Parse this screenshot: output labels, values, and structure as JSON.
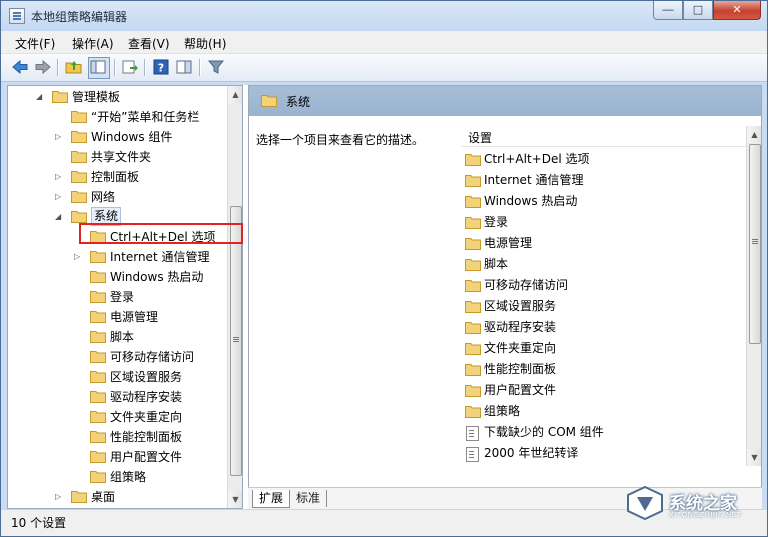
{
  "window": {
    "title": "本地组策略编辑器",
    "caption_minimize": "▭",
    "caption_maximize": "▢",
    "caption_close": "✕"
  },
  "menubar": {
    "items": [
      "文件(F)",
      "操作(A)",
      "查看(V)",
      "帮助(H)"
    ]
  },
  "toolbar": {
    "icons": [
      "back-icon",
      "forward-icon",
      "up-folder-icon",
      "show-hide-tree-icon",
      "export-list-icon",
      "help-icon",
      "properties-pane-icon",
      "filter-icon"
    ]
  },
  "tree": {
    "items": [
      {
        "label": "管理模板",
        "expander": "◢",
        "expanded": true
      },
      {
        "label": "“开始”菜单和任务栏",
        "expander": ""
      },
      {
        "label": "Windows 组件",
        "expander": "▷"
      },
      {
        "label": "共享文件夹",
        "expander": ""
      },
      {
        "label": "控制面板",
        "expander": "▷"
      },
      {
        "label": "网络",
        "expander": "▷"
      },
      {
        "label": "系统",
        "expander": "◢",
        "expanded": true,
        "selected": true
      },
      {
        "label": "Ctrl+Alt+Del 选项",
        "expander": "",
        "highlighted": true
      },
      {
        "label": "Internet 通信管理",
        "expander": "▷"
      },
      {
        "label": "Windows 热启动",
        "expander": ""
      },
      {
        "label": "登录",
        "expander": ""
      },
      {
        "label": "电源管理",
        "expander": ""
      },
      {
        "label": "脚本",
        "expander": ""
      },
      {
        "label": "可移动存储访问",
        "expander": ""
      },
      {
        "label": "区域设置服务",
        "expander": ""
      },
      {
        "label": "驱动程序安装",
        "expander": ""
      },
      {
        "label": "文件夹重定向",
        "expander": ""
      },
      {
        "label": "性能控制面板",
        "expander": ""
      },
      {
        "label": "用户配置文件",
        "expander": ""
      },
      {
        "label": "组策略",
        "expander": ""
      },
      {
        "label": "桌面",
        "expander": "▷"
      }
    ]
  },
  "right_pane": {
    "header_title": "系统",
    "description": "选择一个项目来查看它的描述。",
    "column_header": "设置",
    "items": [
      {
        "label": "Ctrl+Alt+Del 选项",
        "type": "folder"
      },
      {
        "label": "Internet 通信管理",
        "type": "folder"
      },
      {
        "label": "Windows 热启动",
        "type": "folder"
      },
      {
        "label": "登录",
        "type": "folder"
      },
      {
        "label": "电源管理",
        "type": "folder"
      },
      {
        "label": "脚本",
        "type": "folder"
      },
      {
        "label": "可移动存储访问",
        "type": "folder"
      },
      {
        "label": "区域设置服务",
        "type": "folder"
      },
      {
        "label": "驱动程序安装",
        "type": "folder"
      },
      {
        "label": "文件夹重定向",
        "type": "folder"
      },
      {
        "label": "性能控制面板",
        "type": "folder"
      },
      {
        "label": "用户配置文件",
        "type": "folder"
      },
      {
        "label": "组策略",
        "type": "folder"
      },
      {
        "label": "下载缺少的 COM 组件",
        "type": "policy"
      },
      {
        "label": "2000 年世纪转译",
        "type": "policy"
      }
    ]
  },
  "tabs": [
    {
      "label": "扩展",
      "active": true
    },
    {
      "label": "标准",
      "active": false
    }
  ],
  "status": {
    "text": "10 个设置"
  },
  "watermark": {
    "text": "系统之家",
    "sub": "XITONGZHIJIA.NET"
  },
  "colors": {
    "highlight_box": "#e32222",
    "folder_fill": "#f3d37a",
    "header_bg": "#a7bdd7"
  }
}
